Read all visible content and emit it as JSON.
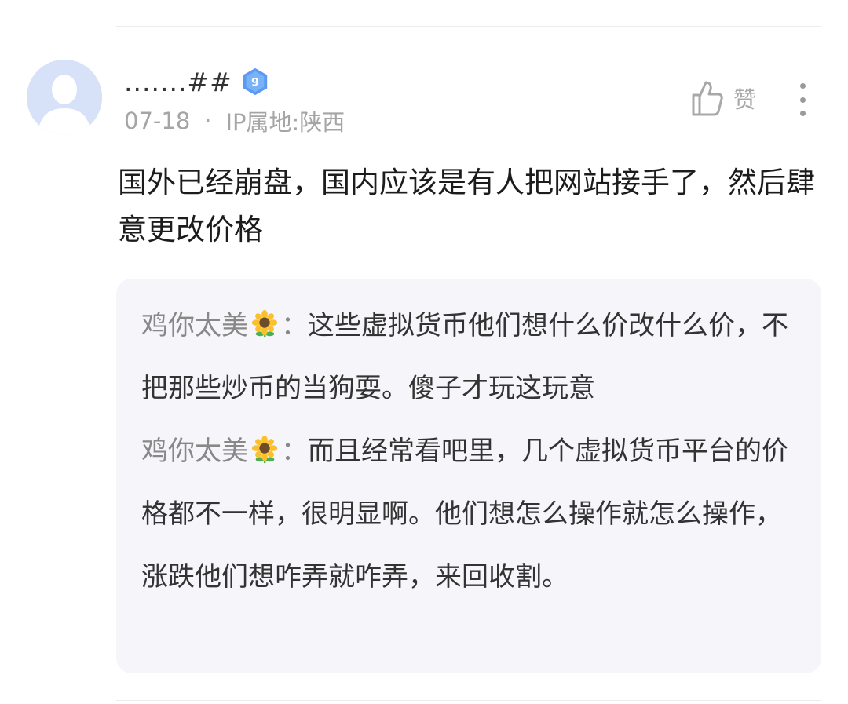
{
  "comment": {
    "user": {
      "name": ".......##",
      "level": "9",
      "avatar_icon": "default-avatar-icon"
    },
    "date": "07-18",
    "separator": "·",
    "ip_location": "IP属地:陕西",
    "like_label": "赞",
    "like_icon": "thumbs-up-icon",
    "more_icon": "more-vertical-icon",
    "text": "国外已经崩盘，国内应该是有人把网站接手了，然后肆意更改价格"
  },
  "replies": [
    {
      "author": "鸡你太美",
      "author_emoji": "sunflower-icon",
      "colon": "：",
      "text": "这些虚拟货币他们想什么价改什么价，不把那些炒币的当狗耍。傻子才玩这玩意"
    },
    {
      "author": "鸡你太美",
      "author_emoji": "sunflower-icon",
      "colon": "：",
      "text": "而且经常看吧里，几个虚拟货币平台的价格都不一样，很明显啊。他们想怎么操作就怎么操作，涨跌他们想咋弄就咋弄，来回收割。"
    }
  ],
  "colors": {
    "avatar_bg": "#d7e1f7",
    "badge_blue": "#5a9af2",
    "reply_bg": "#f6f6fa",
    "meta_gray": "#a5a5a5"
  }
}
